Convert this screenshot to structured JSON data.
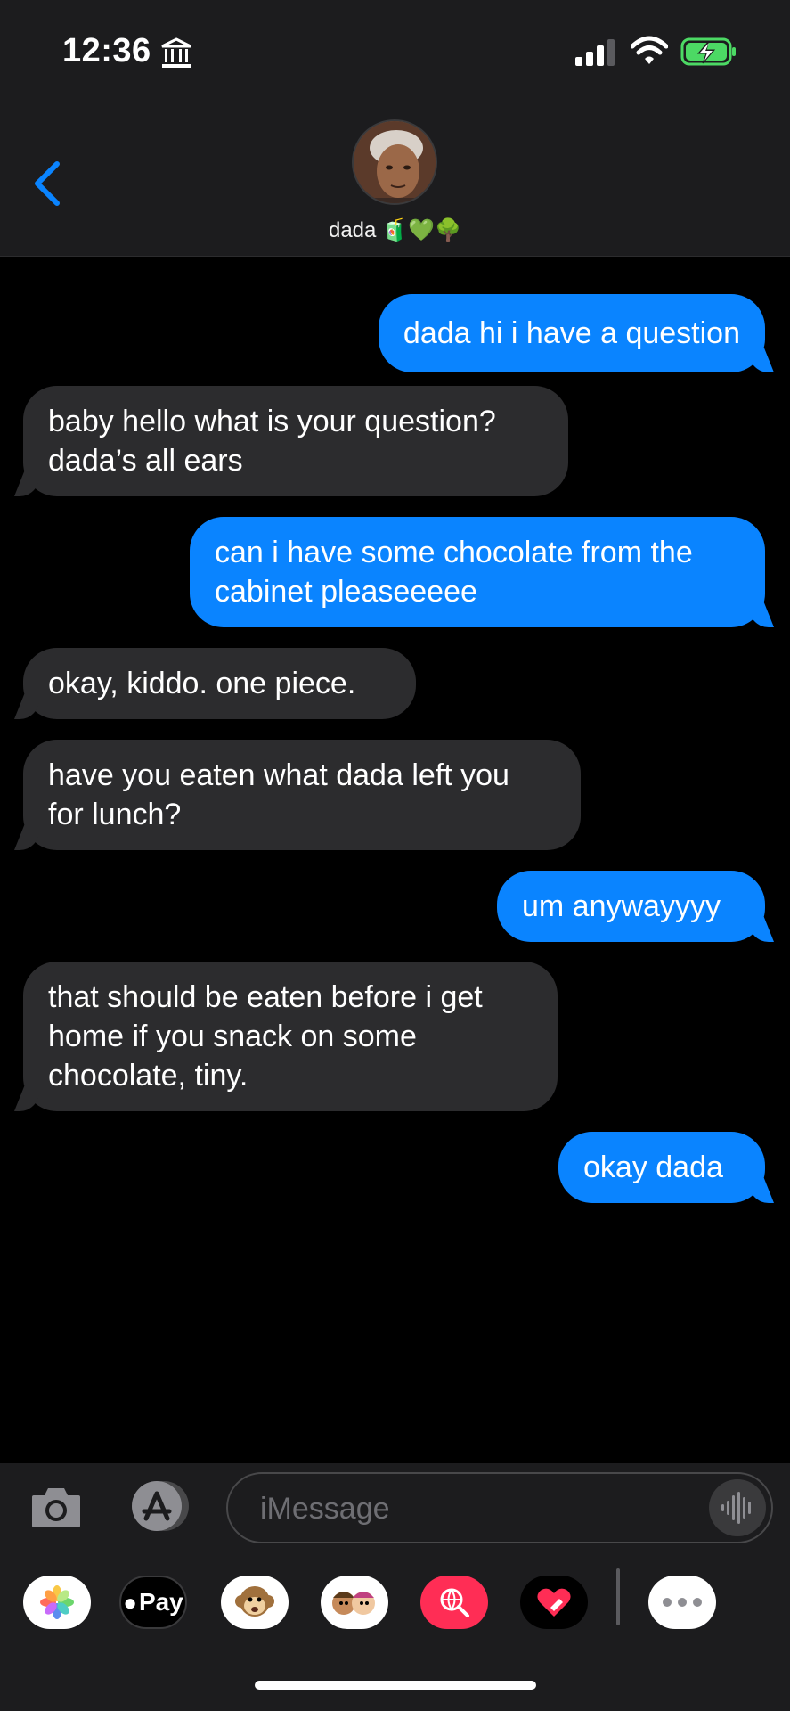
{
  "status_bar": {
    "time": "12:36",
    "icons": [
      "bank-icon",
      "signal-icon",
      "wifi-icon",
      "battery-charging-icon"
    ]
  },
  "header": {
    "contact_name": "dada",
    "contact_emojis": "🧃💚🌳"
  },
  "messages": [
    {
      "direction": "out",
      "text": "dada hi i have a question"
    },
    {
      "direction": "in",
      "text": "baby hello what is your question?\ndada’s all ears"
    },
    {
      "direction": "out",
      "text": "can i have some chocolate from the\ncabinet pleaseeeee"
    },
    {
      "direction": "in",
      "text": "okay, kiddo. one piece."
    },
    {
      "direction": "in",
      "text": "have you eaten what dada left you\nfor lunch?"
    },
    {
      "direction": "out",
      "text": "um anywayyyy"
    },
    {
      "direction": "in",
      "text": "that should be eaten before i get\nhome if you snack on some\nchocolate, tiny."
    },
    {
      "direction": "out",
      "text": "okay dada"
    }
  ],
  "input": {
    "placeholder": "iMessage"
  },
  "apps": [
    {
      "name": "photos-app-icon"
    },
    {
      "name": "apple-pay-app-icon",
      "label": "Pay"
    },
    {
      "name": "animoji-app-icon"
    },
    {
      "name": "memoji-app-icon"
    },
    {
      "name": "image-search-app-icon"
    },
    {
      "name": "digital-touch-app-icon"
    },
    {
      "name": "more-apps-icon"
    }
  ],
  "colors": {
    "outgoing_bubble": "#0a84ff",
    "incoming_bubble": "#2c2c2e",
    "background": "#000000",
    "accent": "#0a84ff"
  }
}
